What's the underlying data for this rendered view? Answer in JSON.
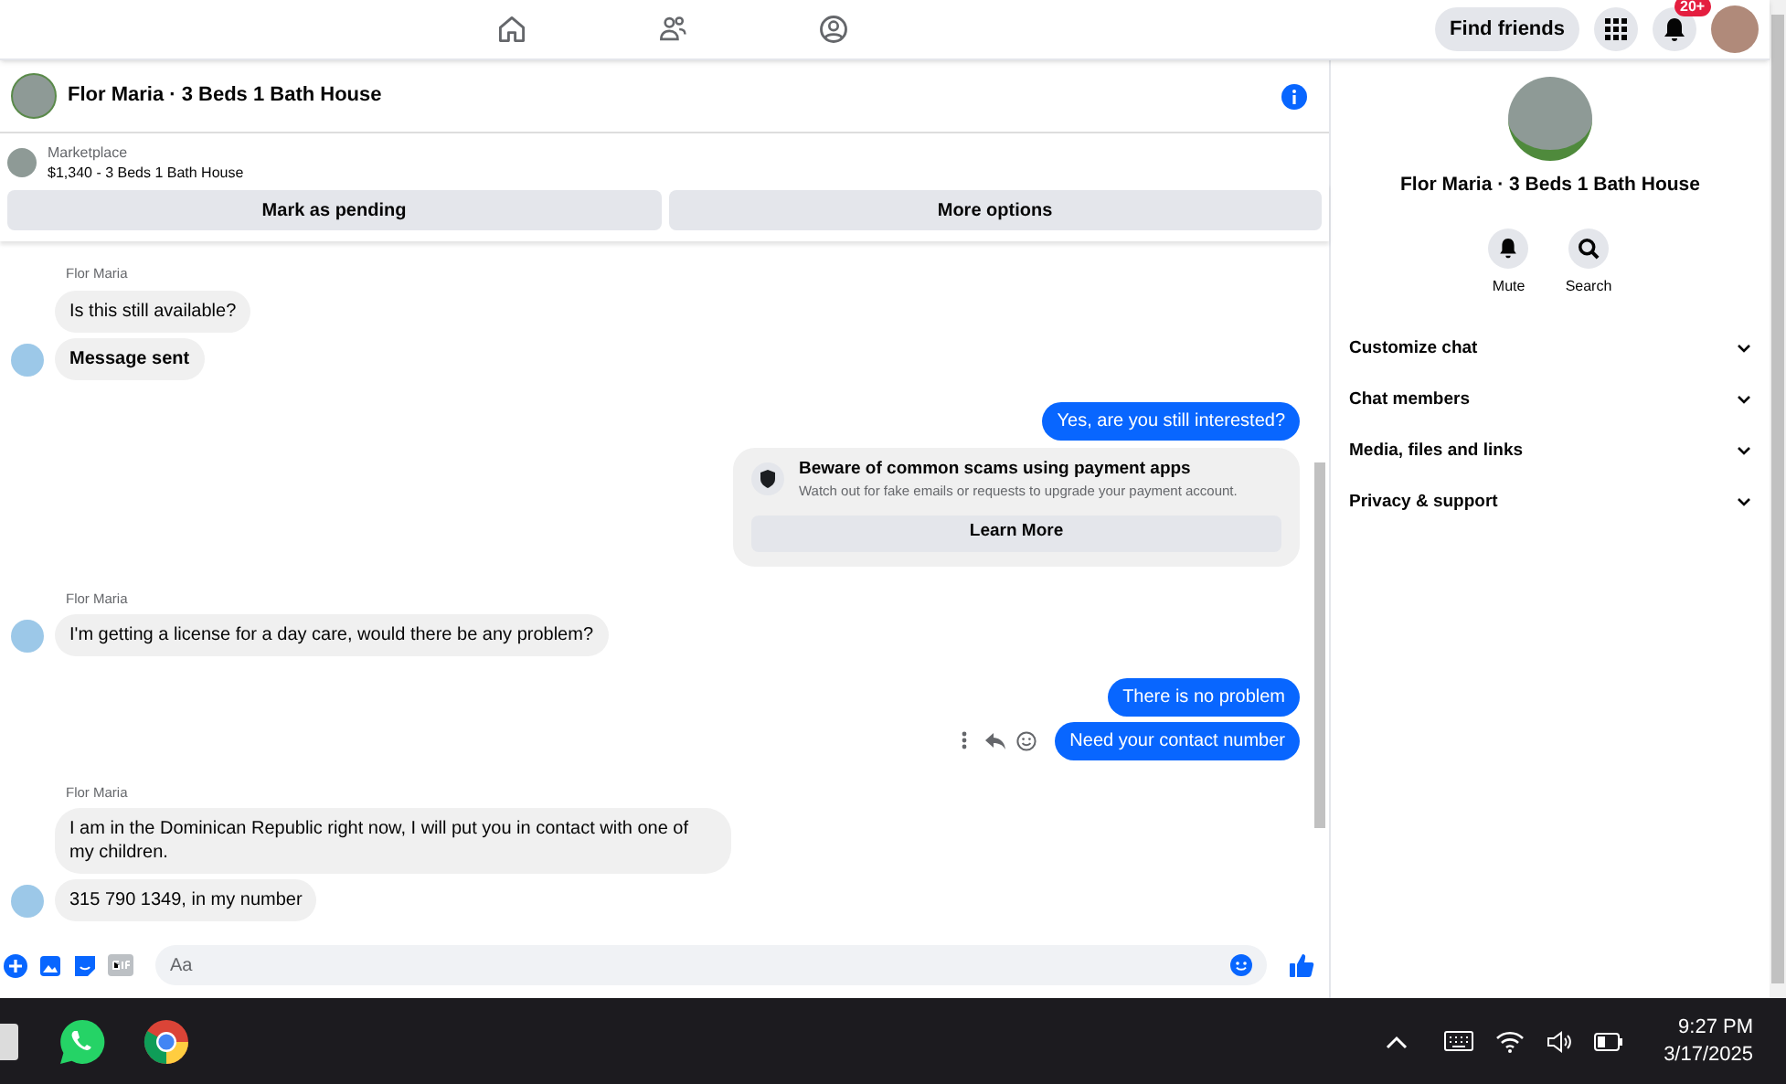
{
  "top_nav": {
    "tabs": [
      {
        "kind": "home",
        "selected": false
      },
      {
        "kind": "friends",
        "selected": false
      },
      {
        "kind": "profile",
        "selected": false
      }
    ],
    "find_friends": "Find friends",
    "notification_badge": "20+"
  },
  "chat_header": {
    "title": "Flor Maria · 3 Beds 1 Bath House"
  },
  "listing": {
    "source": "Marketplace",
    "summary": "$1,340 - 3 Beds 1 Bath House",
    "buttons": [
      "Mark as pending",
      "More options"
    ]
  },
  "messages": [
    {
      "kind": "sender",
      "text": "Flor Maria"
    },
    {
      "kind": "incoming",
      "text": "Is this still available?",
      "bold": false,
      "avatar": false
    },
    {
      "kind": "incoming",
      "text": "Message sent",
      "bold": true,
      "avatar": true
    },
    {
      "kind": "outgoing",
      "text": "Yes, are you still interested?",
      "actions_shown": false
    },
    {
      "kind": "notice",
      "title": "Beware of common scams using payment apps",
      "body": "Watch out for fake emails or requests to upgrade your payment account.",
      "button": "Learn More"
    },
    {
      "kind": "sender",
      "text": "Flor Maria"
    },
    {
      "kind": "incoming",
      "text": "I'm getting a license for a day care, would there be any problem?",
      "bold": false,
      "avatar": true
    },
    {
      "kind": "outgoing",
      "text": "There is no problem",
      "actions_shown": false
    },
    {
      "kind": "outgoing",
      "text": "Need your contact number",
      "actions_shown": true
    },
    {
      "kind": "sender",
      "text": "Flor Maria"
    },
    {
      "kind": "incoming",
      "text": "I am in the Dominican Republic right now, I will put you in contact with one of my children.",
      "bold": false,
      "avatar": false
    },
    {
      "kind": "incoming",
      "text": "315 790 1349, in my number",
      "bold": false,
      "avatar": true
    }
  ],
  "composer": {
    "placeholder": "Aa"
  },
  "details": {
    "title": "Flor Maria · 3 Beds 1 Bath House",
    "actions": [
      {
        "kind": "mute",
        "label": "Mute"
      },
      {
        "kind": "search",
        "label": "Search"
      }
    ],
    "sections": [
      {
        "label": "Customize chat",
        "expanded": false
      },
      {
        "label": "Chat members",
        "expanded": false
      },
      {
        "label": "Media, files and links",
        "expanded": false
      },
      {
        "label": "Privacy & support",
        "expanded": false
      }
    ]
  },
  "taskbar": {
    "time": "9:27 PM",
    "date": "3/17/2025"
  }
}
